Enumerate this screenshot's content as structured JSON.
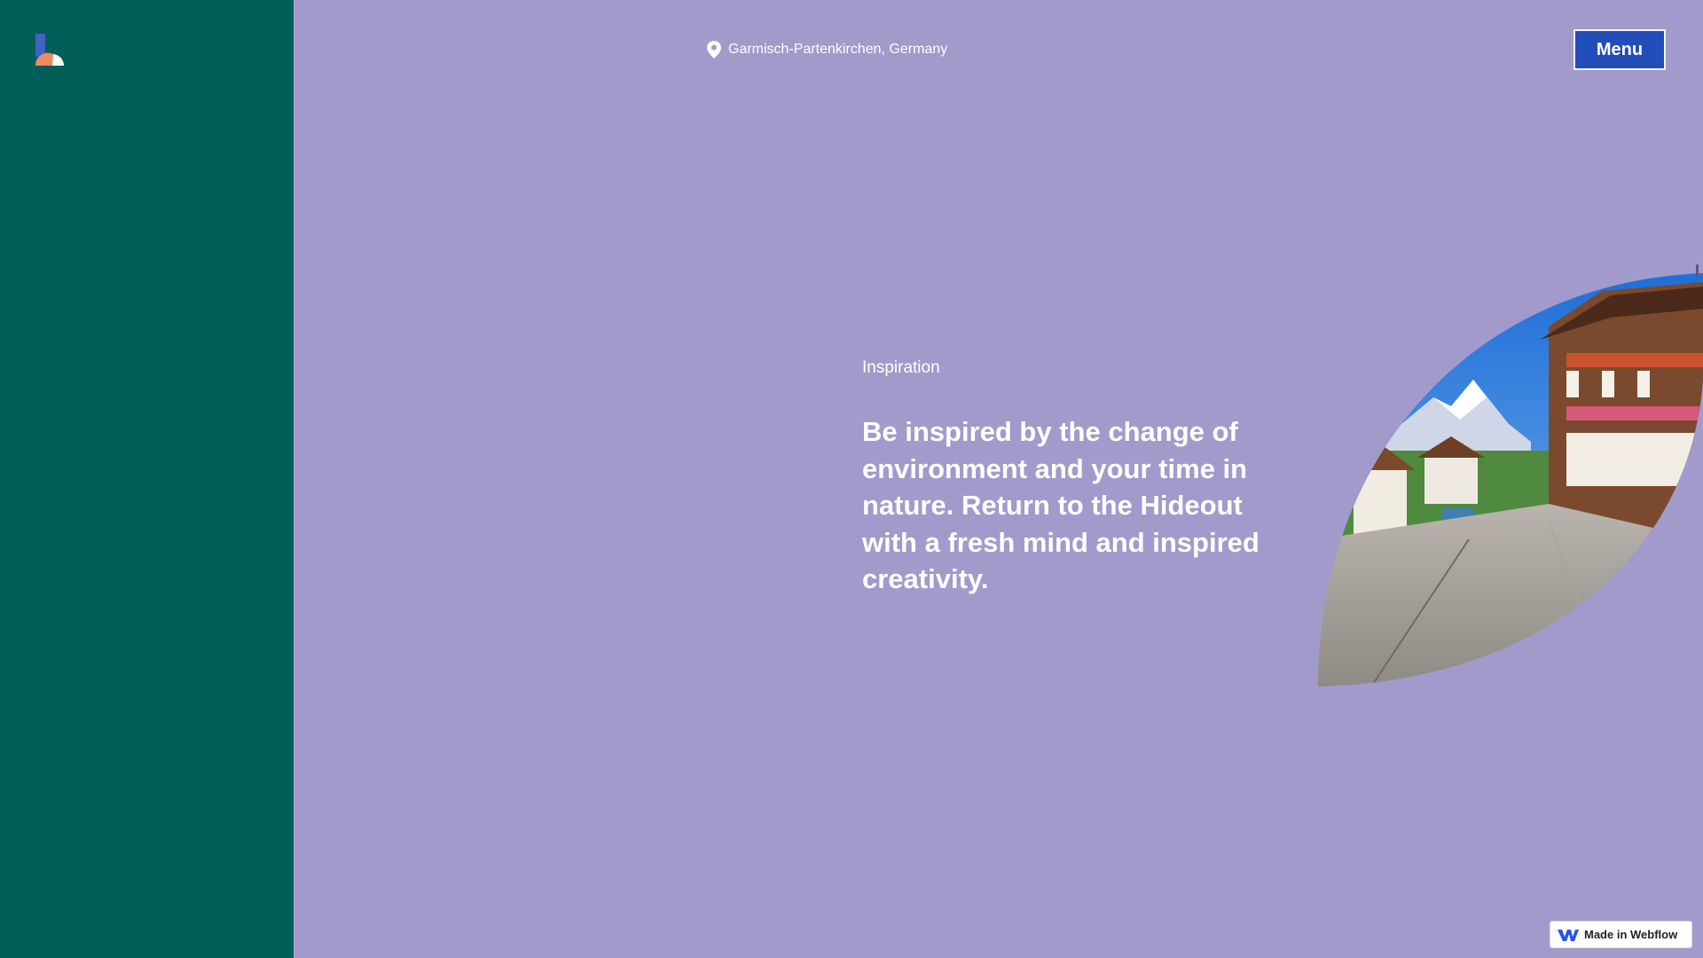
{
  "location": {
    "icon": "location-pin-icon",
    "text": "Garmisch-Partenkirchen, Germany"
  },
  "menu": {
    "label": "Menu"
  },
  "section": {
    "eyebrow": "Inspiration",
    "headline": "Be inspired by the change of environment and your time in nature. Return to the Hideout with a fresh mind and inspired creativity."
  },
  "badge": {
    "icon": "webflow-icon",
    "label": "Made in Webflow"
  },
  "colors": {
    "background": "#a29acb",
    "sidebar": "#005e58",
    "menu_button": "#234db8",
    "text": "#ffffff"
  }
}
